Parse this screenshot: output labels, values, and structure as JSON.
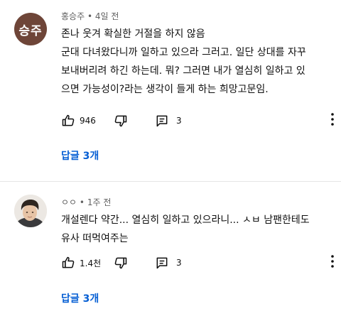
{
  "comments": [
    {
      "avatar_text": "승주",
      "avatar_color": "#6e4538",
      "author": "홍승주",
      "separator": "•",
      "time": "4일 전",
      "lines": [
        "존나 웃겨 확실한 거절을 하지 않음",
        "군대 다녀왔다니까 일하고 있으라 그러고. 일단 상대를 자꾸",
        "보내버리려 하긴 하는데. 뭐? 그러면 내가 열심히 일하고 있",
        "으면 가능성이?라는 생각이 들게 하는 희망고문임."
      ],
      "likes": "946",
      "reply_count": "3",
      "replies_label": "답글 3개"
    },
    {
      "author": "ㅇㅇ",
      "separator": "•",
      "time": "1주 전",
      "lines": [
        "개설렌다 약간... 열심히 일하고 있으라니... ㅅㅂ 남팬한테도",
        "유사 떠먹여주는"
      ],
      "likes": "1.4천",
      "reply_count": "3",
      "replies_label": "답글 3개"
    }
  ],
  "icons": {
    "like": "thumbs-up-icon",
    "dislike": "thumbs-down-icon",
    "reply": "comment-icon",
    "more": "more-vertical-icon"
  },
  "colors": {
    "link": "#065fd4",
    "meta": "#606060"
  }
}
